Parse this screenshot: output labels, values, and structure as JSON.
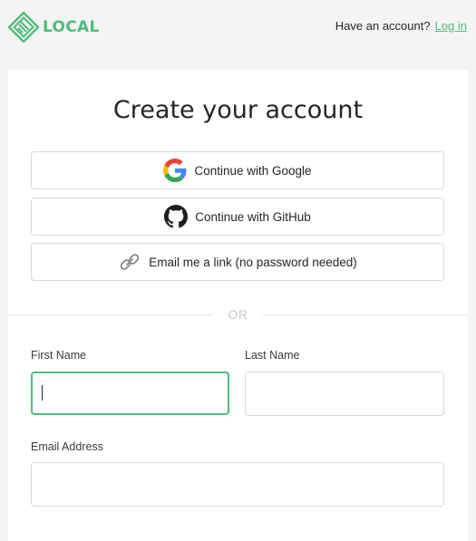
{
  "header": {
    "logo_text": "LOCAL",
    "prompt": "Have an account?",
    "login_link": "Log in"
  },
  "card": {
    "title": "Create your account",
    "social": {
      "google_label": "Continue with Google",
      "github_label": "Continue with GitHub",
      "email_link_label": "Email me a link (no password needed)"
    },
    "divider_text": "OR",
    "form": {
      "first_name": {
        "label": "First Name",
        "value": "",
        "focused": true
      },
      "last_name": {
        "label": "Last Name",
        "value": ""
      },
      "email": {
        "label": "Email Address",
        "value": ""
      }
    }
  },
  "icons": {
    "logo": "local-logo-icon",
    "google": "google-icon",
    "github": "github-icon",
    "link": "link-icon"
  },
  "colors": {
    "brand_green": "#51bb7b",
    "background": "#f4f4f4",
    "card": "#ffffff",
    "border": "#d8d8d8",
    "divider_text": "#c6c6c6"
  }
}
